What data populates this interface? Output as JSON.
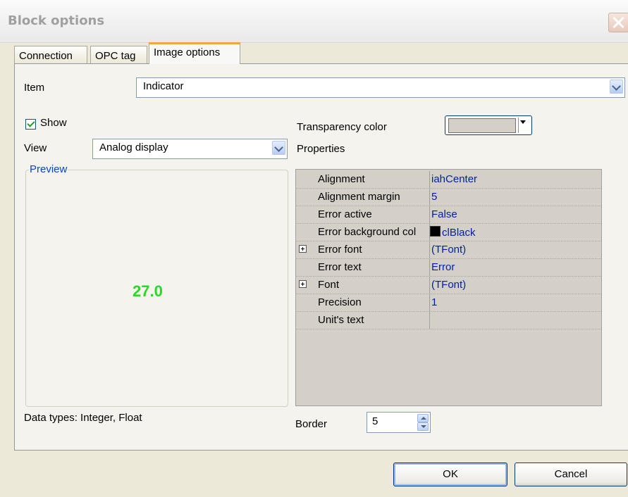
{
  "window": {
    "title": "Block options"
  },
  "tabs": [
    {
      "label": "Connection",
      "active": false
    },
    {
      "label": "OPC tag",
      "active": false
    },
    {
      "label": "Image options",
      "active": true
    }
  ],
  "item": {
    "label": "Item",
    "value": "Indicator"
  },
  "show": {
    "label": "Show",
    "checked": true
  },
  "view": {
    "label": "View",
    "value": "Analog display"
  },
  "preview": {
    "label": "Preview",
    "value": "27.0",
    "value_color": "#22dd22"
  },
  "data_types": "Data types: Integer, Float",
  "transparency": {
    "label": "Transparency color",
    "color": "#d4d0c8"
  },
  "properties": {
    "label": "Properties",
    "rows": [
      {
        "name": "Alignment",
        "value": "iahCenter",
        "expandable": false
      },
      {
        "name": "Alignment margin",
        "value": "5",
        "expandable": false
      },
      {
        "name": "Error active",
        "value": "False",
        "expandable": false
      },
      {
        "name": "Error background col",
        "value": "clBlack",
        "expandable": false,
        "swatch": "#000000"
      },
      {
        "name": "Error font",
        "value": "(TFont)",
        "expandable": true
      },
      {
        "name": "Error text",
        "value": "Error",
        "expandable": false
      },
      {
        "name": "Font",
        "value": "(TFont)",
        "expandable": true
      },
      {
        "name": "Precision",
        "value": "1",
        "expandable": false
      },
      {
        "name": "Unit's text",
        "value": "",
        "expandable": false
      }
    ]
  },
  "border": {
    "label": "Border",
    "value": "5"
  },
  "buttons": {
    "ok": "OK",
    "cancel": "Cancel"
  },
  "colors": {
    "tab_accent": "#f0a73a",
    "group_label": "#0046d5",
    "prop_value": "#001fa8"
  }
}
